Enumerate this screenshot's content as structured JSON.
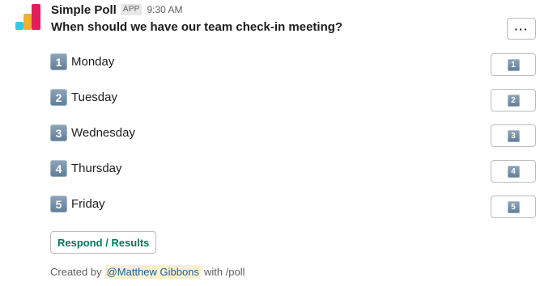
{
  "app": {
    "name": "Simple Poll",
    "badge": "APP",
    "timestamp": "9:30 AM",
    "logo_colors": [
      "#36c5f0",
      "#ecb22e",
      "#e01e5a"
    ]
  },
  "poll": {
    "question": "When should we have our team check-in meeting?",
    "more_label": "···",
    "options": [
      {
        "num": "1",
        "label": "Monday"
      },
      {
        "num": "2",
        "label": "Tuesday"
      },
      {
        "num": "3",
        "label": "Wednesday"
      },
      {
        "num": "4",
        "label": "Thursday"
      },
      {
        "num": "5",
        "label": "Friday"
      }
    ],
    "respond_label": "Respond / Results"
  },
  "footer": {
    "prefix": "Created by",
    "mention": "@Matthew Gibbons",
    "suffix": "with /poll"
  }
}
